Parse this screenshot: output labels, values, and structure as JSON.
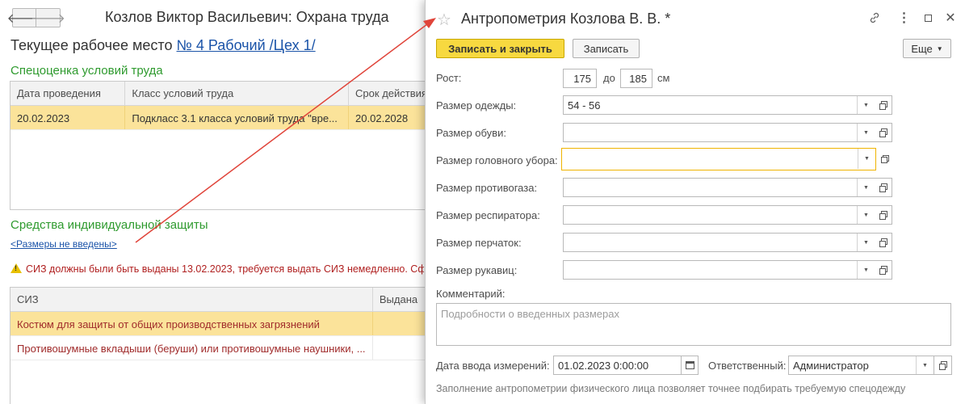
{
  "background": {
    "title": "Козлов Виктор Васильевич: Охрана труда",
    "nav_back": "🡐",
    "nav_forward": "🡒",
    "workplace_label": "Текущее рабочее место",
    "workplace_link": "№ 4 Рабочий /Цех 1/",
    "sout_section": "Спецоценка условий труда",
    "sout_table": {
      "headers": [
        "Дата проведения",
        "Класс условий труда",
        "Срок действия"
      ],
      "rows": [
        [
          "20.02.2023",
          "Подкласс 3.1 класса условий труда \"вре...",
          "20.02.2028"
        ]
      ]
    },
    "siz_section": "Средства индивидуальной защиты",
    "siz_link": "<Размеры не введены>",
    "warning_text": "СИЗ должны были быть выданы 13.02.2023, требуется выдать СИЗ немедленно. Сф",
    "siz_table": {
      "headers": [
        "СИЗ",
        "Выдана"
      ],
      "rows": [
        [
          "Костюм для защиты от общих производственных загрязнений",
          ""
        ],
        [
          "Противошумные вкладыши (беруши) или противошумные наушники, ...",
          ""
        ]
      ]
    }
  },
  "dialog": {
    "title": "Антропометрия Козлова В. В. *",
    "buttons": {
      "save_close": "Записать и закрыть",
      "save": "Записать",
      "more": "Еще"
    },
    "height": {
      "label": "Рост:",
      "from": "175",
      "to_label": "до",
      "to": "185",
      "unit": "см"
    },
    "fields": [
      {
        "label": "Размер одежды:",
        "value": "54 - 56"
      },
      {
        "label": "Размер обуви:",
        "value": ""
      },
      {
        "label": "Размер головного убора:",
        "value": ""
      },
      {
        "label": "Размер противогаза:",
        "value": ""
      },
      {
        "label": "Размер респиратора:",
        "value": ""
      },
      {
        "label": "Размер перчаток:",
        "value": ""
      },
      {
        "label": "Размер рукавиц:",
        "value": ""
      }
    ],
    "comment": {
      "label": "Комментарий:",
      "placeholder": "Подробности о введенных размерах"
    },
    "date_label": "Дата ввода измерений:",
    "date_value": "01.02.2023  0:00:00",
    "responsible_label": "Ответственный:",
    "responsible_value": "Администратор",
    "hint": "Заполнение антропометрии физического лица позволяет точнее подбирать требуемую спецодежду"
  },
  "colors": {
    "accent_green": "#2e9a2e",
    "link_blue": "#1a53a8",
    "primary_button": "#f7d940",
    "selected_row": "#fbe39a",
    "warning_red": "#b02020",
    "arrow_red": "#e0443a"
  }
}
